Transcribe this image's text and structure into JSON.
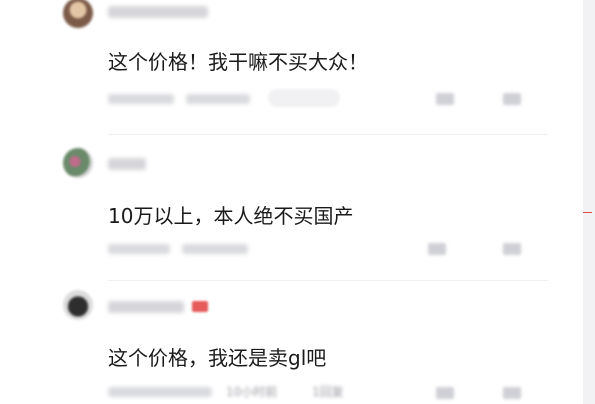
{
  "comments": [
    {
      "text": "这个价格！我干嘛不买大众！",
      "username_blurred": "用户名已模糊",
      "avatar_colors": [
        "#caa88a",
        "#8a6a55"
      ]
    },
    {
      "text": "10万以上，本人绝不买国产",
      "username_blurred": "已模糊",
      "avatar_colors": [
        "#6a8a6a",
        "#c06b8a"
      ]
    },
    {
      "text": "这个价格，我还是卖gl吧",
      "username_blurred": "用户名已模糊",
      "meta_visible": "10小时前",
      "meta_reply": "1回复",
      "avatar_colors": [
        "#3a3a3a",
        "#d8d8d8"
      ]
    }
  ],
  "colors": {
    "accent_red": "#e24a4a",
    "text_main": "#1a1a1a",
    "background": "#ffffff"
  },
  "icons": [
    "like-icon",
    "comment-icon"
  ]
}
